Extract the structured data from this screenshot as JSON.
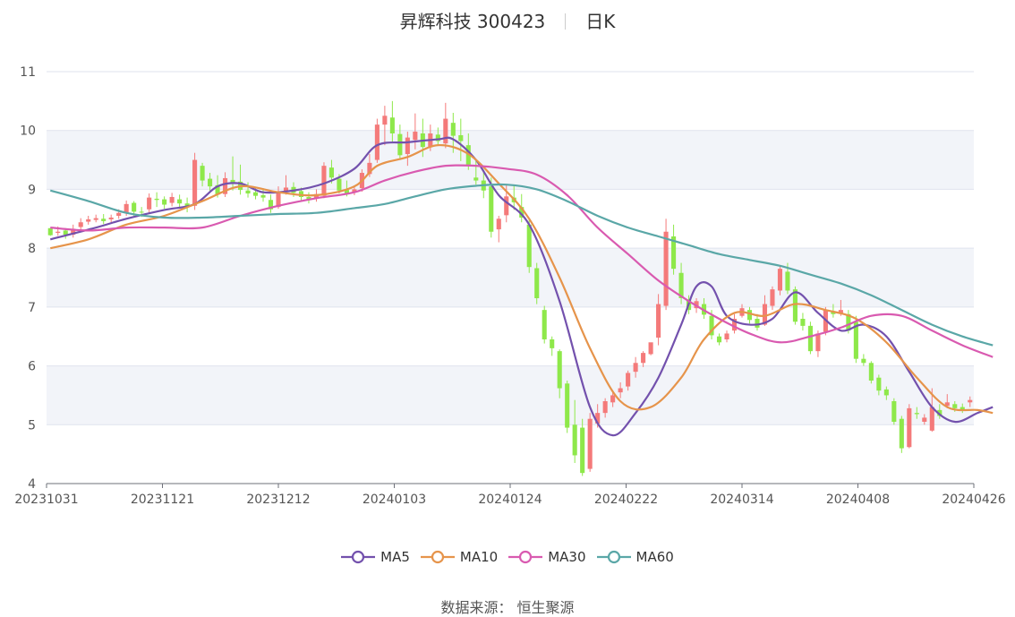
{
  "header": {
    "title": "昇辉科技 300423",
    "period": "日K"
  },
  "source": "数据来源： 恒生聚源",
  "colors": {
    "up": "#f47a7a",
    "down": "#8ee84a",
    "grid": "#dfe3ee",
    "band": "#f2f4f9"
  },
  "chart_data": {
    "type": "candlestick",
    "title": "昇辉科技 300423",
    "subtitle": "日K",
    "ylim": [
      4,
      11
    ],
    "yticks": [
      4,
      5,
      6,
      7,
      8,
      9,
      10,
      11
    ],
    "xtick_labels": [
      "20231031",
      "20231121",
      "20231212",
      "20240103",
      "20240124",
      "20240222",
      "20240314",
      "20240408",
      "20240426"
    ],
    "grid": true,
    "legend_position": "bottom",
    "ohlc": [
      [
        8.34,
        8.34,
        8.22,
        8.21
      ],
      [
        8.26,
        8.37,
        8.28,
        8.21
      ],
      [
        8.3,
        8.34,
        8.23,
        8.16
      ],
      [
        8.23,
        8.4,
        8.33,
        8.18
      ],
      [
        8.36,
        8.51,
        8.44,
        8.32
      ],
      [
        8.45,
        8.55,
        8.49,
        8.4
      ],
      [
        8.48,
        8.57,
        8.51,
        8.44
      ],
      [
        8.5,
        8.58,
        8.46,
        8.41
      ],
      [
        8.49,
        8.57,
        8.52,
        8.44
      ],
      [
        8.55,
        8.66,
        8.6,
        8.5
      ],
      [
        8.6,
        8.81,
        8.75,
        8.55
      ],
      [
        8.77,
        8.8,
        8.62,
        8.55
      ],
      [
        8.62,
        8.7,
        8.61,
        8.53
      ],
      [
        8.66,
        8.93,
        8.86,
        8.6
      ],
      [
        8.84,
        8.95,
        8.82,
        8.7
      ],
      [
        8.83,
        8.88,
        8.74,
        8.67
      ],
      [
        8.77,
        8.94,
        8.87,
        8.71
      ],
      [
        8.83,
        8.91,
        8.76,
        8.7
      ],
      [
        8.76,
        8.86,
        8.7,
        8.61
      ],
      [
        8.72,
        9.62,
        9.5,
        8.65
      ],
      [
        9.4,
        9.45,
        9.15,
        9.05
      ],
      [
        9.18,
        9.28,
        9.05,
        8.96
      ],
      [
        9.07,
        9.24,
        8.91,
        8.86
      ],
      [
        8.92,
        9.29,
        9.19,
        8.87
      ],
      [
        9.16,
        9.56,
        9.09,
        8.98
      ],
      [
        9.13,
        9.42,
        8.99,
        8.91
      ],
      [
        8.98,
        9.12,
        8.93,
        8.86
      ],
      [
        8.95,
        9.04,
        8.89,
        8.83
      ],
      [
        8.9,
        9.02,
        8.86,
        8.79
      ],
      [
        8.82,
        8.91,
        8.66,
        8.6
      ],
      [
        8.7,
        9.05,
        8.95,
        8.67
      ],
      [
        8.97,
        9.24,
        9.03,
        8.91
      ],
      [
        9.04,
        9.12,
        8.94,
        8.87
      ],
      [
        8.97,
        9.03,
        8.87,
        8.81
      ],
      [
        8.87,
        8.95,
        8.82,
        8.76
      ],
      [
        8.84,
        9.0,
        8.92,
        8.79
      ],
      [
        8.89,
        9.46,
        9.4,
        8.85
      ],
      [
        9.37,
        9.5,
        9.2,
        9.1
      ],
      [
        9.18,
        9.26,
        8.98,
        8.93
      ],
      [
        8.99,
        9.15,
        8.93,
        8.88
      ],
      [
        8.95,
        9.05,
        9.0,
        8.9
      ],
      [
        9.02,
        9.34,
        9.28,
        8.96
      ],
      [
        9.26,
        9.6,
        9.45,
        9.21
      ],
      [
        9.5,
        10.2,
        10.1,
        9.45
      ],
      [
        10.1,
        10.42,
        10.25,
        9.75
      ],
      [
        10.22,
        10.5,
        9.95,
        9.8
      ],
      [
        9.94,
        10.1,
        9.58,
        9.5
      ],
      [
        9.6,
        9.98,
        9.88,
        9.4
      ],
      [
        9.84,
        10.29,
        9.98,
        9.68
      ],
      [
        9.95,
        10.2,
        9.72,
        9.55
      ],
      [
        9.73,
        10.1,
        9.95,
        9.65
      ],
      [
        9.93,
        10.05,
        9.82,
        9.75
      ],
      [
        9.78,
        10.47,
        10.2,
        9.7
      ],
      [
        10.13,
        10.3,
        9.91,
        9.62
      ],
      [
        9.92,
        10.2,
        9.82,
        9.48
      ],
      [
        9.75,
        9.95,
        9.42,
        9.33
      ],
      [
        9.2,
        9.48,
        9.15,
        9.08
      ],
      [
        9.15,
        9.32,
        8.98,
        8.85
      ],
      [
        9.05,
        9.2,
        8.28,
        8.18
      ],
      [
        8.32,
        8.55,
        8.5,
        8.1
      ],
      [
        8.56,
        9.08,
        8.88,
        8.44
      ],
      [
        8.86,
        9.08,
        8.78,
        8.65
      ],
      [
        8.7,
        8.92,
        8.52,
        8.44
      ],
      [
        8.4,
        8.49,
        7.68,
        7.58
      ],
      [
        7.66,
        7.75,
        7.15,
        7.05
      ],
      [
        6.95,
        7.02,
        6.45,
        6.38
      ],
      [
        6.45,
        6.5,
        6.3,
        6.17
      ],
      [
        6.25,
        6.28,
        5.62,
        5.45
      ],
      [
        5.7,
        5.75,
        4.95,
        4.86
      ],
      [
        5.0,
        5.42,
        4.48,
        4.35
      ],
      [
        4.95,
        5.1,
        4.18,
        4.13
      ],
      [
        4.25,
        5.2,
        5.1,
        4.2
      ],
      [
        5.02,
        5.35,
        5.2,
        4.95
      ],
      [
        5.2,
        5.45,
        5.4,
        5.12
      ],
      [
        5.38,
        5.55,
        5.5,
        5.3
      ],
      [
        5.55,
        5.72,
        5.62,
        5.45
      ],
      [
        5.65,
        5.92,
        5.88,
        5.58
      ],
      [
        5.9,
        6.15,
        6.05,
        5.8
      ],
      [
        6.05,
        6.25,
        6.22,
        5.98
      ],
      [
        6.2,
        6.3,
        6.4,
        6.18
      ],
      [
        6.48,
        7.22,
        7.05,
        6.35
      ],
      [
        7.02,
        8.5,
        8.28,
        6.95
      ],
      [
        8.2,
        8.4,
        7.65,
        7.55
      ],
      [
        7.58,
        7.75,
        7.15,
        7.05
      ],
      [
        7.13,
        7.2,
        6.95,
        6.88
      ],
      [
        6.98,
        7.15,
        7.1,
        6.9
      ],
      [
        7.05,
        7.15,
        6.87,
        6.8
      ],
      [
        6.85,
        6.95,
        6.52,
        6.45
      ],
      [
        6.5,
        6.55,
        6.4,
        6.35
      ],
      [
        6.45,
        6.6,
        6.55,
        6.4
      ],
      [
        6.6,
        6.88,
        6.8,
        6.55
      ],
      [
        6.85,
        7.05,
        6.98,
        6.82
      ],
      [
        6.95,
        7.0,
        6.78,
        6.72
      ],
      [
        6.8,
        6.88,
        6.65,
        6.6
      ],
      [
        6.7,
        7.2,
        7.05,
        6.68
      ],
      [
        7.02,
        7.35,
        7.3,
        6.95
      ],
      [
        7.28,
        7.7,
        7.65,
        7.2
      ],
      [
        7.6,
        7.75,
        7.28,
        7.22
      ],
      [
        7.3,
        7.35,
        6.75,
        6.7
      ],
      [
        6.8,
        6.9,
        6.68,
        6.6
      ],
      [
        6.68,
        6.75,
        6.25,
        6.2
      ],
      [
        6.25,
        6.6,
        6.55,
        6.15
      ],
      [
        6.58,
        7.0,
        6.95,
        6.52
      ],
      [
        6.92,
        7.05,
        6.88,
        6.82
      ],
      [
        6.9,
        7.12,
        6.95,
        6.85
      ],
      [
        6.88,
        6.95,
        6.6,
        6.55
      ],
      [
        6.75,
        6.85,
        6.12,
        6.05
      ],
      [
        6.12,
        6.2,
        6.05,
        6.0
      ],
      [
        6.05,
        6.08,
        5.75,
        5.7
      ],
      [
        5.8,
        5.85,
        5.58,
        5.5
      ],
      [
        5.6,
        5.65,
        5.5,
        5.42
      ],
      [
        5.4,
        5.45,
        5.05,
        5.0
      ],
      [
        5.1,
        5.15,
        4.6,
        4.52
      ],
      [
        4.62,
        5.35,
        5.28,
        4.6
      ],
      [
        5.2,
        5.3,
        5.18,
        5.1
      ],
      [
        5.05,
        5.18,
        5.12,
        5.0
      ],
      [
        4.9,
        5.62,
        5.3,
        4.88
      ],
      [
        5.25,
        5.35,
        5.15,
        5.1
      ],
      [
        5.32,
        5.52,
        5.38,
        5.28
      ],
      [
        5.35,
        5.4,
        5.28,
        5.22
      ],
      [
        5.3,
        5.36,
        5.26,
        5.2
      ],
      [
        5.38,
        5.48,
        5.42,
        5.3
      ]
    ],
    "series": [
      {
        "name": "MA5",
        "color": "#7351ad",
        "points": [
          [
            0,
            8.15
          ],
          [
            6,
            8.35
          ],
          [
            10,
            8.5
          ],
          [
            15,
            8.65
          ],
          [
            19,
            8.75
          ],
          [
            22,
            9.05
          ],
          [
            25,
            9.1
          ],
          [
            28,
            8.95
          ],
          [
            32,
            8.98
          ],
          [
            36,
            9.1
          ],
          [
            40,
            9.35
          ],
          [
            43,
            9.75
          ],
          [
            47,
            9.8
          ],
          [
            51,
            9.85
          ],
          [
            53,
            9.85
          ],
          [
            56,
            9.5
          ],
          [
            59,
            8.9
          ],
          [
            63,
            8.4
          ],
          [
            67,
            7.1
          ],
          [
            71,
            5.3
          ],
          [
            74,
            4.82
          ],
          [
            77,
            5.2
          ],
          [
            80,
            5.8
          ],
          [
            83,
            6.7
          ],
          [
            85,
            7.35
          ],
          [
            87,
            7.35
          ],
          [
            89,
            6.85
          ],
          [
            92,
            6.7
          ],
          [
            95,
            6.8
          ],
          [
            98,
            7.25
          ],
          [
            101,
            6.9
          ],
          [
            104,
            6.6
          ],
          [
            107,
            6.7
          ],
          [
            110,
            6.5
          ],
          [
            113,
            5.9
          ],
          [
            116,
            5.3
          ],
          [
            119,
            5.05
          ],
          [
            122,
            5.2
          ],
          [
            124,
            5.3
          ]
        ]
      },
      {
        "name": "MA10",
        "color": "#e6944b",
        "points": [
          [
            0,
            8.0
          ],
          [
            5,
            8.15
          ],
          [
            10,
            8.4
          ],
          [
            15,
            8.55
          ],
          [
            20,
            8.8
          ],
          [
            25,
            9.05
          ],
          [
            30,
            8.95
          ],
          [
            35,
            8.9
          ],
          [
            40,
            9.05
          ],
          [
            43,
            9.4
          ],
          [
            47,
            9.55
          ],
          [
            51,
            9.75
          ],
          [
            55,
            9.6
          ],
          [
            59,
            9.1
          ],
          [
            63,
            8.5
          ],
          [
            67,
            7.5
          ],
          [
            71,
            6.3
          ],
          [
            75,
            5.4
          ],
          [
            79,
            5.3
          ],
          [
            83,
            5.8
          ],
          [
            86,
            6.45
          ],
          [
            90,
            6.9
          ],
          [
            94,
            6.85
          ],
          [
            98,
            7.05
          ],
          [
            102,
            6.95
          ],
          [
            106,
            6.8
          ],
          [
            110,
            6.4
          ],
          [
            114,
            5.8
          ],
          [
            118,
            5.3
          ],
          [
            122,
            5.25
          ],
          [
            124,
            5.2
          ]
        ]
      },
      {
        "name": "MA30",
        "color": "#d95ab0",
        "points": [
          [
            0,
            8.35
          ],
          [
            5,
            8.3
          ],
          [
            10,
            8.35
          ],
          [
            15,
            8.35
          ],
          [
            20,
            8.35
          ],
          [
            25,
            8.55
          ],
          [
            30,
            8.72
          ],
          [
            35,
            8.85
          ],
          [
            40,
            8.95
          ],
          [
            44,
            9.15
          ],
          [
            48,
            9.3
          ],
          [
            52,
            9.4
          ],
          [
            56,
            9.4
          ],
          [
            60,
            9.35
          ],
          [
            64,
            9.25
          ],
          [
            68,
            8.9
          ],
          [
            72,
            8.35
          ],
          [
            76,
            7.9
          ],
          [
            80,
            7.45
          ],
          [
            84,
            7.1
          ],
          [
            88,
            6.8
          ],
          [
            92,
            6.55
          ],
          [
            96,
            6.4
          ],
          [
            100,
            6.5
          ],
          [
            104,
            6.65
          ],
          [
            108,
            6.85
          ],
          [
            112,
            6.85
          ],
          [
            116,
            6.6
          ],
          [
            120,
            6.35
          ],
          [
            124,
            6.15
          ]
        ]
      },
      {
        "name": "MA60",
        "color": "#5aa7a7",
        "points": [
          [
            0,
            8.98
          ],
          [
            5,
            8.8
          ],
          [
            10,
            8.6
          ],
          [
            15,
            8.52
          ],
          [
            20,
            8.52
          ],
          [
            25,
            8.55
          ],
          [
            30,
            8.58
          ],
          [
            35,
            8.6
          ],
          [
            40,
            8.68
          ],
          [
            44,
            8.75
          ],
          [
            48,
            8.88
          ],
          [
            52,
            9.0
          ],
          [
            56,
            9.06
          ],
          [
            60,
            9.08
          ],
          [
            64,
            9.0
          ],
          [
            68,
            8.8
          ],
          [
            72,
            8.55
          ],
          [
            76,
            8.35
          ],
          [
            80,
            8.2
          ],
          [
            84,
            8.05
          ],
          [
            88,
            7.9
          ],
          [
            92,
            7.8
          ],
          [
            96,
            7.7
          ],
          [
            100,
            7.55
          ],
          [
            104,
            7.4
          ],
          [
            108,
            7.2
          ],
          [
            112,
            6.95
          ],
          [
            116,
            6.7
          ],
          [
            120,
            6.5
          ],
          [
            124,
            6.35
          ]
        ]
      }
    ]
  }
}
